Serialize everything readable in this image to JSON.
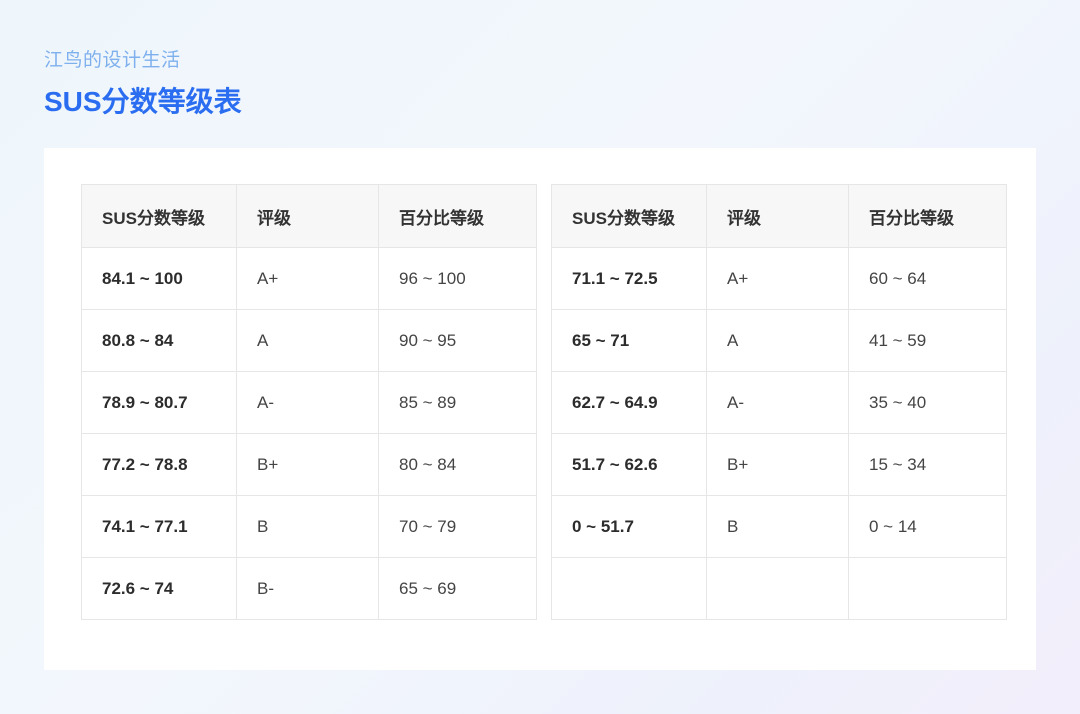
{
  "header": {
    "subtitle": "江鸟的设计生活",
    "title": "SUS分数等级表"
  },
  "columns": [
    "SUS分数等级",
    "评级",
    "百分比等级"
  ],
  "tables": [
    {
      "rows": [
        {
          "score": "84.1 ~ 100",
          "grade": "A+",
          "percentile": "96 ~ 100"
        },
        {
          "score": "80.8 ~ 84",
          "grade": "A",
          "percentile": "90 ~ 95"
        },
        {
          "score": "78.9 ~ 80.7",
          "grade": "A-",
          "percentile": "85 ~ 89"
        },
        {
          "score": "77.2 ~ 78.8",
          "grade": "B+",
          "percentile": "80 ~ 84"
        },
        {
          "score": "74.1 ~ 77.1",
          "grade": "B",
          "percentile": "70 ~ 79"
        },
        {
          "score": "72.6 ~ 74",
          "grade": "B-",
          "percentile": "65 ~ 69"
        }
      ]
    },
    {
      "rows": [
        {
          "score": "71.1 ~ 72.5",
          "grade": "A+",
          "percentile": "60 ~ 64"
        },
        {
          "score": "65 ~ 71",
          "grade": "A",
          "percentile": "41 ~ 59"
        },
        {
          "score": "62.7 ~ 64.9",
          "grade": "A-",
          "percentile": "35 ~ 40"
        },
        {
          "score": "51.7 ~ 62.6",
          "grade": "B+",
          "percentile": "15 ~ 34"
        },
        {
          "score": "0 ~ 51.7",
          "grade": "B",
          "percentile": "0 ~ 14"
        },
        {
          "score": "",
          "grade": "",
          "percentile": ""
        }
      ]
    }
  ]
}
